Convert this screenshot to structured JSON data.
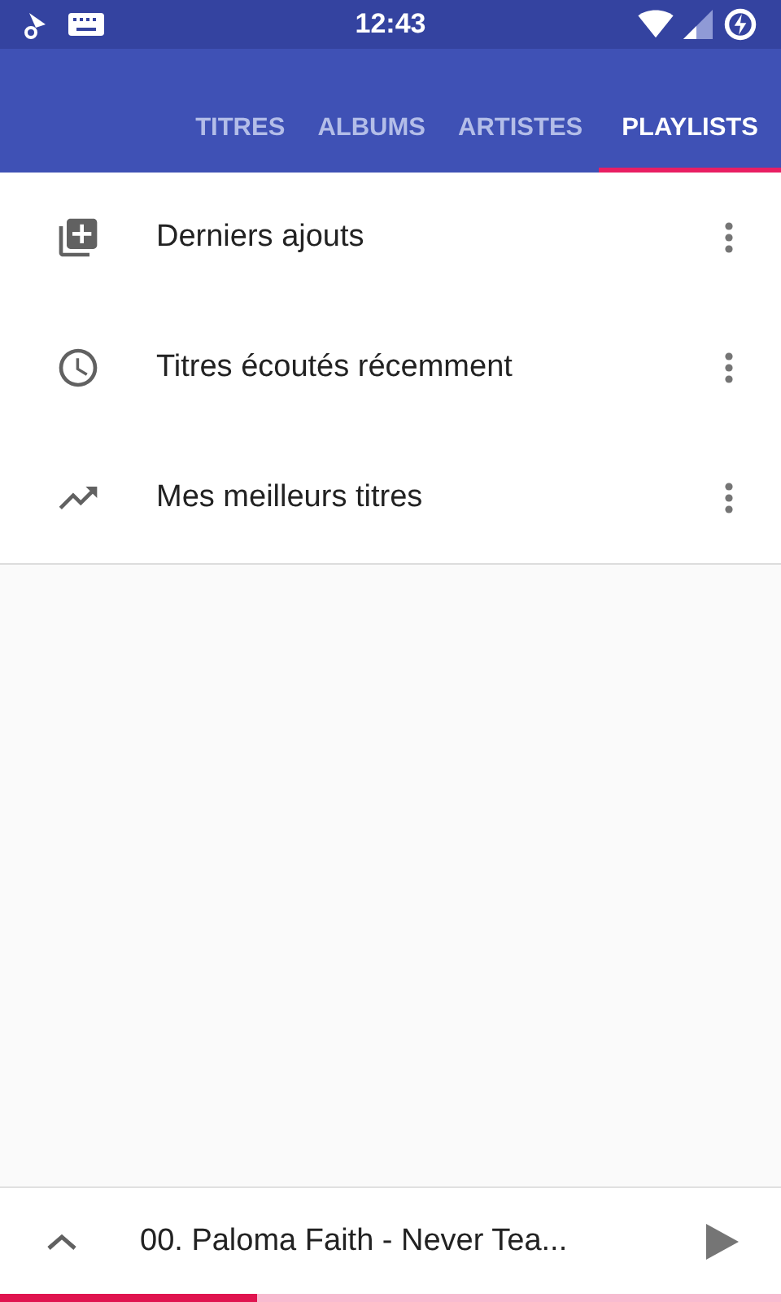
{
  "status_bar": {
    "time": "12:43"
  },
  "tabs": [
    {
      "label": "TITRES",
      "selected": false
    },
    {
      "label": "ALBUMS",
      "selected": false
    },
    {
      "label": "ARTISTES",
      "selected": false
    },
    {
      "label": "PLAYLISTS",
      "selected": true
    }
  ],
  "playlists": [
    {
      "kind": "recent-added",
      "title": "Derniers ajouts"
    },
    {
      "kind": "recent-played",
      "title": "Titres écoutés récemment"
    },
    {
      "kind": "top",
      "title": "Mes meilleurs titres"
    }
  ],
  "now_playing": {
    "title": "00. Paloma Faith - Never Tea...",
    "level": 0.33
  }
}
